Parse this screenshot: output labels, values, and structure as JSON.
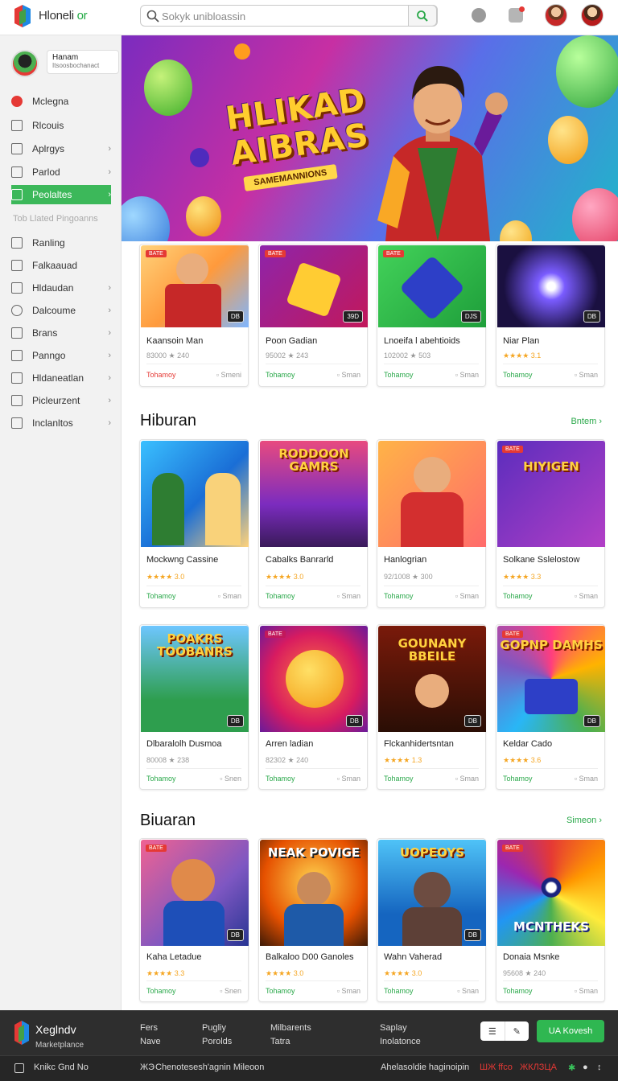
{
  "header": {
    "brand": "Hloneli",
    "brand_accent": "or",
    "search_placeholder": "Sokyk unibloassin"
  },
  "sidebar": {
    "profile_name": "Hanam",
    "profile_sub": "Itsoosbochanact",
    "items": [
      {
        "label": "Mclegna",
        "chevron": false,
        "active": false
      },
      {
        "label": "Rlcouis",
        "chevron": false,
        "active": false
      },
      {
        "label": "Aplrgys",
        "chevron": true,
        "active": false
      },
      {
        "label": "Parlod",
        "chevron": true,
        "active": false
      },
      {
        "label": "Peolaltes",
        "chevron": true,
        "active": true
      }
    ],
    "section_label": "Tob Llated Pingoanns",
    "items2": [
      {
        "label": "Ranling",
        "chevron": false
      },
      {
        "label": "Falkaauad",
        "chevron": false
      },
      {
        "label": "Hldaudan",
        "chevron": true
      },
      {
        "label": "Dalcoume",
        "chevron": true
      },
      {
        "label": "Brans",
        "chevron": true
      },
      {
        "label": "Panngo",
        "chevron": true
      },
      {
        "label": "Hldaneatlan",
        "chevron": true
      },
      {
        "label": "Picleurzent",
        "chevron": true
      },
      {
        "label": "Inclanltos",
        "chevron": true
      }
    ]
  },
  "hero": {
    "title_line1": "HLIKAD",
    "title_line2": "AIBRAS",
    "subtitle": "SAMEMANNIONS"
  },
  "row1": [
    {
      "tag": "BATE",
      "badge": "DB",
      "title": "Kaansoin Man",
      "meta": "83000 ★ 240",
      "price": "Tohamoy",
      "action": "Smeni",
      "price_red": true
    },
    {
      "tag": "BATE",
      "badge": "39D",
      "title": "Poon Gadian",
      "meta": "95002 ★ 243",
      "price": "Tohamoy",
      "action": "Sman",
      "price_red": false
    },
    {
      "tag": "BATE",
      "badge": "DJS",
      "title": "Lnoeifa l abehtioids",
      "meta": "102002 ★ 503",
      "price": "Tohamoy",
      "action": "Sman",
      "price_red": false
    },
    {
      "tag": "",
      "badge": "DB",
      "title": "Niar Plan",
      "meta": "★★★★ 3.1",
      "price": "Tohamoy",
      "action": "Sman",
      "price_red": false
    }
  ],
  "section1": {
    "title": "Hiburan",
    "link": "Bntem"
  },
  "row2": [
    {
      "thumb_text": "",
      "title": "Mockwng Cassine",
      "meta": "★★★★ 3.0",
      "price": "Tohamoy",
      "action": "Sman"
    },
    {
      "thumb_text": "RODDOON GAMRS",
      "title": "Cabalks Banrarld",
      "meta": "★★★★ 3.0",
      "price": "Tohamoy",
      "action": "Sman"
    },
    {
      "thumb_text": "",
      "title": "Hanlogrian",
      "meta": "92/1008 ★ 300",
      "price": "Tohamoy",
      "action": "Sman"
    },
    {
      "thumb_text": "HIYIGEN",
      "title": "Solkane Sslelostow",
      "meta": "★★★★ 3.3",
      "price": "Tohamoy",
      "action": "Sman"
    }
  ],
  "row3": [
    {
      "thumb_text": "POAKRS TOOBANRS",
      "badge": "DB",
      "title": "Dlbaralolh Dusmoa",
      "meta": "80008 ★ 238",
      "price": "Tohamoy",
      "action": "Snen"
    },
    {
      "thumb_text": "",
      "badge": "DB",
      "title": "Arren ladian",
      "meta": "82302 ★ 240",
      "price": "Tohamoy",
      "action": "Sman"
    },
    {
      "thumb_text": "GOUNANY BBEILE",
      "badge": "DB",
      "title": "Flckanhidertsntan",
      "meta": "★★★★ 1.3",
      "price": "Tohamoy",
      "action": "Sman"
    },
    {
      "thumb_text": "GOPNP DAMHS",
      "badge": "DB",
      "title": "Keldar Cado",
      "meta": "★★★★ 3.6",
      "price": "Tohamoy",
      "action": "Sman"
    }
  ],
  "section2": {
    "title": "Biuaran",
    "link": "Simeon"
  },
  "row4": [
    {
      "thumb_text": "",
      "badge": "DB",
      "title": "Kaha Letadue",
      "meta": "★★★★ 3.3",
      "price": "Tohamoy",
      "action": "Snen"
    },
    {
      "thumb_text": "NEAK POVIGE",
      "badge": "",
      "title": "Balkaloo D00 Ganoles",
      "meta": "★★★★ 3.0",
      "price": "Tohamoy",
      "action": "Sman"
    },
    {
      "thumb_text": "UOPEOYS",
      "badge": "DB",
      "title": "Wahn Vaherad",
      "meta": "★★★★ 3.0",
      "price": "Tohamoy",
      "action": "Snan"
    },
    {
      "thumb_text": "MCNTHEKS",
      "badge": "",
      "title": "Donaia Msnke",
      "meta": "95608 ★ 240",
      "price": "Tohamoy",
      "action": "Sman"
    }
  ],
  "footer": {
    "brand": "Xeglndv",
    "brand_accent": "Xegl",
    "tagline": "Marketplance",
    "col1": [
      "Fers",
      "Nave"
    ],
    "col2": [
      "Pugliy",
      "Porolds"
    ],
    "col3": [
      "Milbarents",
      "Tatra"
    ],
    "col4": [
      "Saplay",
      "Inolatonce"
    ],
    "cta": "UA Kovesh",
    "bottom_left": "Knikc Gnd No",
    "bottom_mid": "Chenotesesh'agnin Mileoon",
    "bottom_mid_prefix": "ЖЭ",
    "bottom_right": "Ahelasoldie haginoipin",
    "bottom_right_red": "ШЖ ffco",
    "bottom_right_red2": "ЖКЛЗЦА"
  }
}
